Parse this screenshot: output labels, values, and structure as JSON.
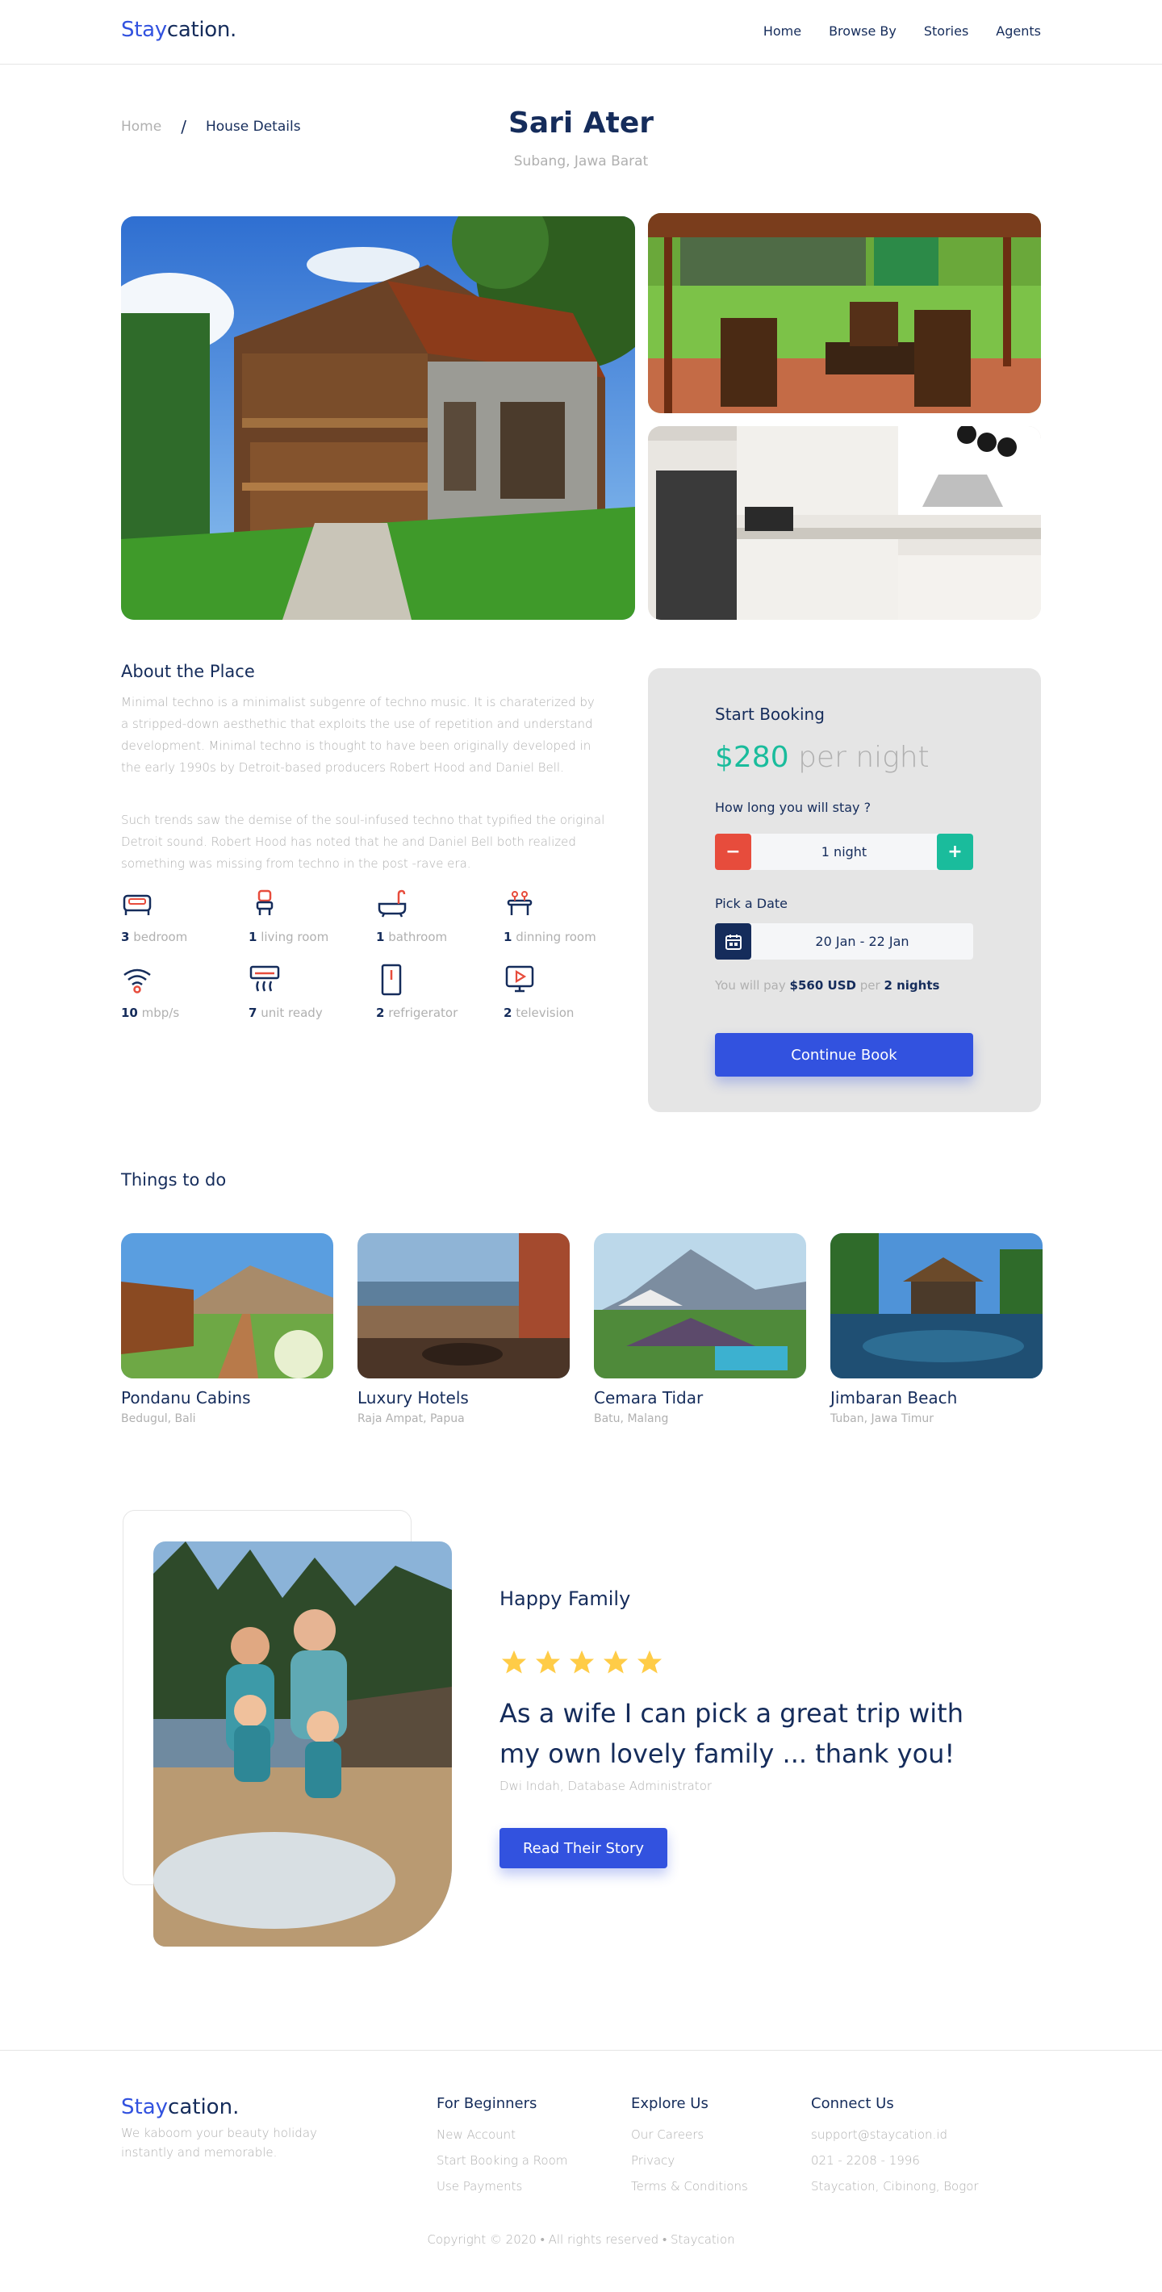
{
  "header": {
    "brand_part1": "Stay",
    "brand_part2": "cation.",
    "nav": [
      "Home",
      "Browse By",
      "Stories",
      "Agents"
    ]
  },
  "breadcrumb": {
    "home": "Home",
    "separator": "/",
    "current": "House Details"
  },
  "property": {
    "title": "Sari Ater",
    "location": "Subang, Jawa Barat"
  },
  "gallery": {
    "main": "house-exterior-photo",
    "top": "dining-terrace-photo",
    "bottom": "kitchen-photo"
  },
  "about": {
    "title": "About the Place",
    "p1": "Minimal techno is a minimalist subgenre of techno music. It is charaterized by a stripped-down aesthethic that exploits the use of repetition and understand development. Minimal techno is thought to have been originally developed in the early 1990s by Detroit-based producers Robert Hood and Daniel Bell.",
    "p2": "Such trends saw the demise of the soul-infused techno that typified the original Detroit sound. Robert Hood has noted that he and Daniel Bell both realized something was missing from techno in the post -rave era.",
    "features": [
      {
        "icon": "bed-icon",
        "count": "3",
        "label": "bedroom"
      },
      {
        "icon": "sofa-icon",
        "count": "1",
        "label": "living room"
      },
      {
        "icon": "bathtub-icon",
        "count": "1",
        "label": "bathroom"
      },
      {
        "icon": "dining-table-icon",
        "count": "1",
        "label": "dinning room"
      },
      {
        "icon": "wifi-icon",
        "count": "10",
        "label": "mbp/s"
      },
      {
        "icon": "air-conditioner-icon",
        "count": "7",
        "label": "unit ready"
      },
      {
        "icon": "refrigerator-icon",
        "count": "2",
        "label": "refrigerator"
      },
      {
        "icon": "television-icon",
        "count": "2",
        "label": "television"
      }
    ]
  },
  "booking": {
    "title": "Start Booking",
    "price": "$280",
    "per": "per night",
    "question": "How long you will stay ?",
    "minus": "−",
    "plus": "+",
    "duration": "1 night",
    "date_label": "Pick a Date",
    "date_range": "20 Jan - 22 Jan",
    "pay_prefix": "You will pay",
    "pay_amount": "$560 USD",
    "pay_mid": "per",
    "pay_nights": "2 nights",
    "cta": "Continue Book"
  },
  "things": {
    "title": "Things to do",
    "items": [
      {
        "name": "Pondanu Cabins",
        "location": "Bedugul, Bali"
      },
      {
        "name": "Luxury Hotels",
        "location": "Raja Ampat, Papua"
      },
      {
        "name": "Cemara Tidar",
        "location": "Batu, Malang"
      },
      {
        "name": "Jimbaran Beach",
        "location": "Tuban, Jawa Timur"
      }
    ]
  },
  "testimonial": {
    "title": "Happy Family",
    "rating": 5,
    "quote": "As a wife I can pick a great trip with my own lovely family ... thank you!",
    "author": "Dwi Indah, Database Administrator",
    "cta": "Read Their Story"
  },
  "footer": {
    "brand_part1": "Stay",
    "brand_part2": "cation.",
    "tagline": "We kaboom your beauty holiday instantly and memorable.",
    "columns": [
      {
        "title": "For Beginners",
        "links": [
          "New Account",
          "Start Booking a Room",
          "Use Payments"
        ]
      },
      {
        "title": "Explore Us",
        "links": [
          "Our Careers",
          "Privacy",
          "Terms & Conditions"
        ]
      },
      {
        "title": "Connect Us",
        "links": [
          "support@staycation.id",
          "021 - 2208 - 1996",
          "Staycation, Cibinong, Bogor"
        ]
      }
    ],
    "copyright": "Copyright © 2020 • All rights reserved • Staycation"
  },
  "colors": {
    "primary": "#3252DF",
    "navy": "#152C5B",
    "teal": "#1ABC9C",
    "red": "#E74C3C",
    "muted": "#B0B0B0",
    "star": "#FFCC47"
  }
}
